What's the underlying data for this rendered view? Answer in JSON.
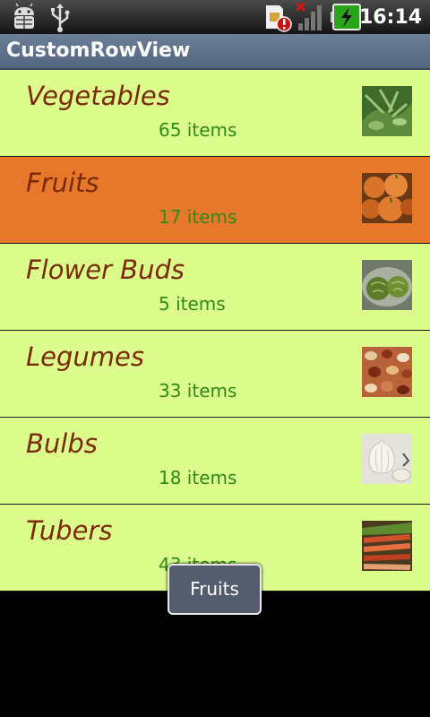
{
  "status_bar": {
    "time": "16:14",
    "icons": [
      "debug-icon",
      "usb-icon",
      "sim-alert-icon",
      "signal-icon",
      "battery-charging-icon"
    ]
  },
  "app": {
    "title": "CustomRowView"
  },
  "list": {
    "items": [
      {
        "name": "Vegetables",
        "count": "65 items",
        "thumbnail": "vegetables-thumbnail",
        "selected": false
      },
      {
        "name": "Fruits",
        "count": "17 items",
        "thumbnail": "fruits-thumbnail",
        "selected": true
      },
      {
        "name": "Flower Buds",
        "count": "5 items",
        "thumbnail": "flower-buds-thumbnail",
        "selected": false
      },
      {
        "name": "Legumes",
        "count": "33 items",
        "thumbnail": "legumes-thumbnail",
        "selected": false
      },
      {
        "name": "Bulbs",
        "count": "18 items",
        "thumbnail": "bulbs-thumbnail",
        "selected": false
      },
      {
        "name": "Tubers",
        "count": "43 items",
        "thumbnail": "tubers-thumbnail",
        "selected": false
      }
    ]
  },
  "toast": {
    "text": "Fruits"
  },
  "colors": {
    "row_background": "#dcfc8c",
    "row_selected": "#e7772b",
    "name_text": "#7a2a08",
    "count_text": "#2f8a1a",
    "titlebar": "#5f7189"
  }
}
